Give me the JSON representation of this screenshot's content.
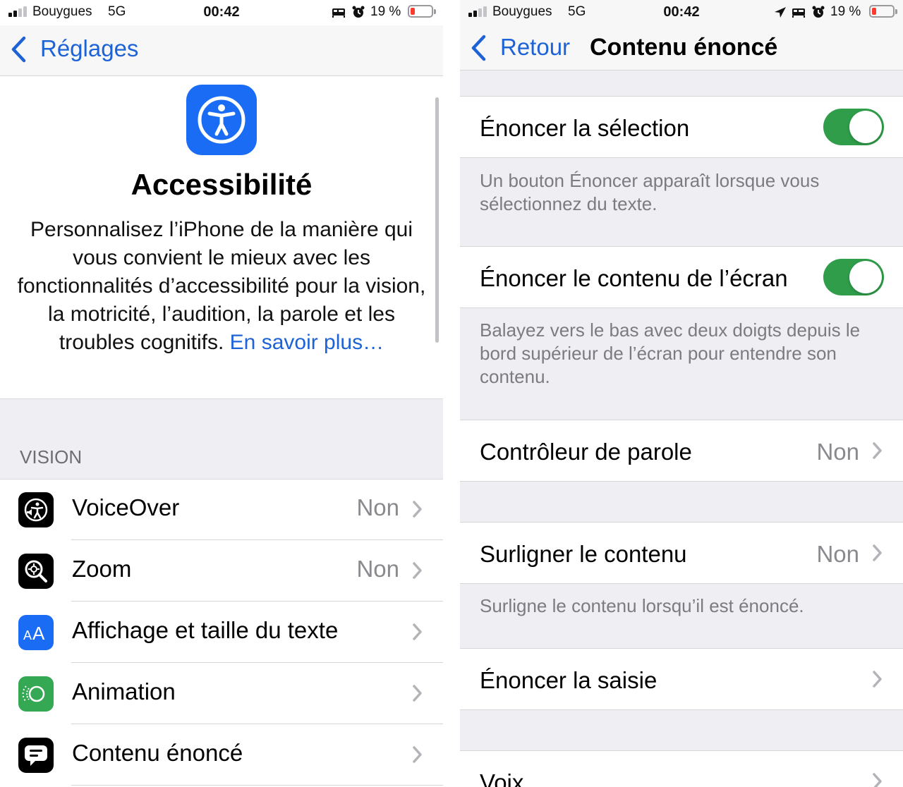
{
  "left": {
    "status": {
      "carrier": "Bouygues",
      "network": "5G",
      "time": "00:42",
      "battery": "19 %",
      "icons": [
        "signal-icon",
        "bed-icon",
        "alarm-icon",
        "battery-icon"
      ]
    },
    "nav": {
      "back_label": "Réglages"
    },
    "hero": {
      "icon": "accessibility-icon",
      "title": "Accessibilité",
      "description": "Personnalisez l’iPhone de la manière qui vous convient le mieux avec les fonctionnalités d’accessibilité pour la vision, la motricité, l’audition, la parole et les troubles cognitifs.",
      "link": "En savoir plus…"
    },
    "section_header": "VISION",
    "rows": [
      {
        "label": "VoiceOver",
        "value": "Non",
        "icon": "voiceover-icon",
        "color": "#000000"
      },
      {
        "label": "Zoom",
        "value": "Non",
        "icon": "zoom-icon",
        "color": "#000000"
      },
      {
        "label": "Affichage et taille du texte",
        "value": "",
        "icon": "text-size-icon",
        "color": "#1a6cf5"
      },
      {
        "label": "Animation",
        "value": "",
        "icon": "motion-icon",
        "color": "#34a853"
      },
      {
        "label": "Contenu énoncé",
        "value": "",
        "icon": "spoken-content-icon",
        "color": "#000000"
      }
    ]
  },
  "right": {
    "status": {
      "carrier": "Bouygues",
      "network": "5G",
      "time": "00:42",
      "battery": "19 %",
      "icons": [
        "signal-icon",
        "location-icon",
        "bed-icon",
        "alarm-icon",
        "battery-icon"
      ]
    },
    "nav": {
      "back_label": "Retour",
      "title": "Contenu énoncé"
    },
    "speak_selection": {
      "label": "Énoncer la sélection",
      "on": true,
      "footer": "Un bouton Énoncer apparaît lorsque vous sélectionnez du texte."
    },
    "speak_screen": {
      "label": "Énoncer le contenu de l’écran",
      "on": true,
      "footer": "Balayez vers le bas avec deux doigts depuis le bord supérieur de l’écran pour entendre son contenu."
    },
    "speech_controller": {
      "label": "Contrôleur de parole",
      "value": "Non"
    },
    "highlight": {
      "label": "Surligner le contenu",
      "value": "Non",
      "footer": "Surligne le contenu lorsqu’il est énoncé."
    },
    "typing_feedback": {
      "label": "Énoncer la saisie"
    },
    "voices": {
      "label": "Voix"
    },
    "accent_color": "#2f9d49",
    "link_color": "#1e63d6"
  }
}
